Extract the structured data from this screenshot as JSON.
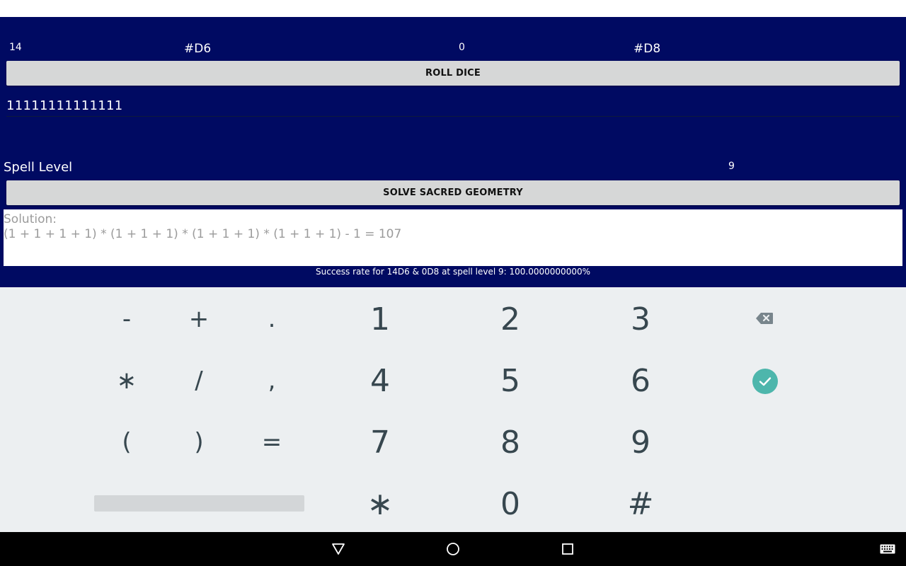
{
  "dice": {
    "d6_count": "14",
    "d6_label": "#D6",
    "d8_count": "0",
    "d8_label": "#D8"
  },
  "roll_button": "ROLL DICE",
  "roll_result": "11111111111111",
  "spell": {
    "label": "Spell Level",
    "value": "9"
  },
  "solve_button": "SOLVE SACRED GEOMETRY",
  "solution": {
    "line1": "Solution:",
    "line2": "(1 + 1 + 1 + 1) * (1 + 1 + 1) * (1 + 1 + 1) * (1 + 1 + 1) - 1 = 107"
  },
  "success_text": "Success rate for 14D6 & 0D8 at spell level 9: 100.0000000000%",
  "keyboard": {
    "sym_keys": [
      "-",
      "+",
      ".",
      "∗",
      "/",
      ",",
      "(",
      ")",
      "="
    ],
    "num_keys": [
      "1",
      "2",
      "3",
      "4",
      "5",
      "6",
      "7",
      "8",
      "9",
      "∗",
      "0",
      "#"
    ],
    "backspace_icon": "backspace-icon",
    "done_icon": "check-icon",
    "accent_color": "#4db6ac"
  },
  "colors": {
    "app_background": "#000a62",
    "button_background": "#d6d7d7",
    "keyboard_background": "#eceff1"
  }
}
